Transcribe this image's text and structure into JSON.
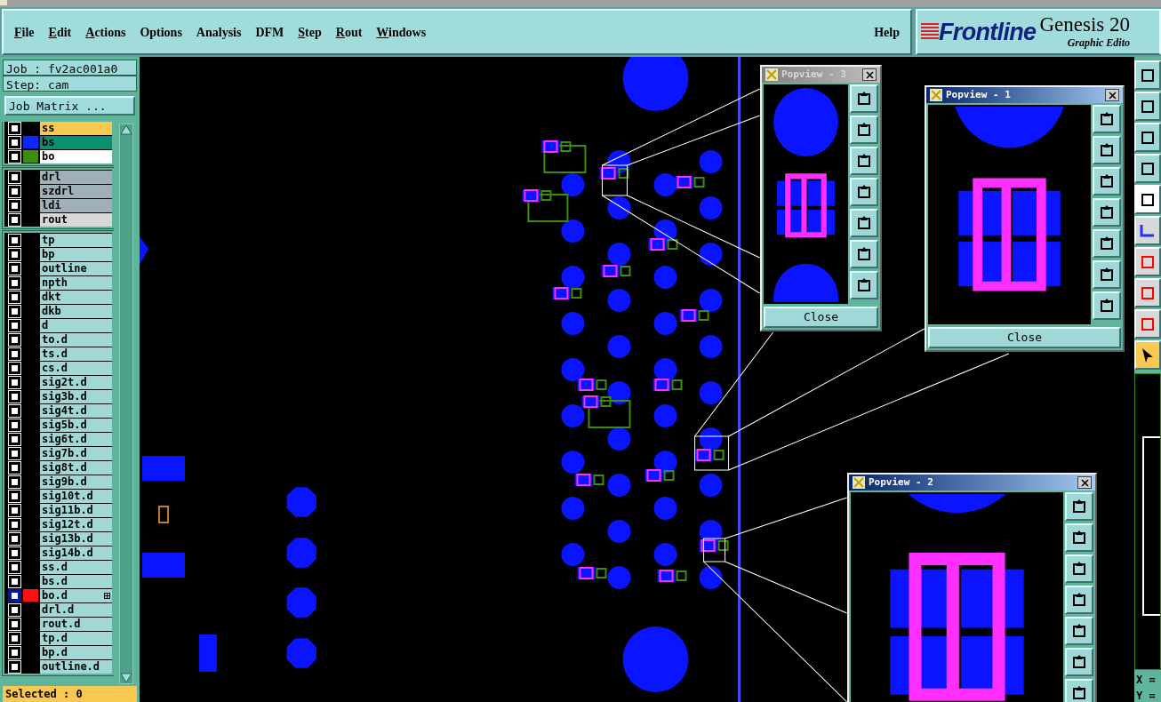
{
  "menu": [
    {
      "label": "File",
      "mnemonic": true
    },
    {
      "label": "Edit",
      "mnemonic": true
    },
    {
      "label": "Actions",
      "mnemonic": true
    },
    {
      "label": "Options",
      "mnemonic": false
    },
    {
      "label": "Analysis",
      "mnemonic": false
    },
    {
      "label": "DFM",
      "mnemonic": false
    },
    {
      "label": "Step",
      "mnemonic": true
    },
    {
      "label": "Rout",
      "mnemonic": true
    },
    {
      "label": "Windows",
      "mnemonic": true
    }
  ],
  "help": {
    "label": "Help"
  },
  "logo": {
    "brand": "Frontline",
    "product": "Genesis 20",
    "subtitle": "Graphic Edito"
  },
  "job": {
    "job": "Job : fv2ac001a0",
    "step": "Step: cam",
    "matrix_button": "Job Matrix ..."
  },
  "layer_groups": [
    {
      "layers": [
        {
          "name": "ss",
          "kind": "highlight",
          "active": false
        },
        {
          "name": "bs",
          "kind": "affected",
          "color": "#0a28ff",
          "active": false
        },
        {
          "name": "bo",
          "kind": "work",
          "color": "#3c8c10",
          "active": false
        }
      ]
    },
    {
      "layers": [
        {
          "name": "drl",
          "kind": "drill",
          "active": false
        },
        {
          "name": "szdrl",
          "kind": "drill",
          "active": false
        },
        {
          "name": "ldi",
          "kind": "drill",
          "active": false
        },
        {
          "name": "rout",
          "kind": "rout",
          "active": false
        }
      ]
    },
    {
      "layers": [
        {
          "name": "tp",
          "kind": "misc",
          "active": false
        },
        {
          "name": "bp",
          "kind": "misc",
          "active": false
        },
        {
          "name": "outline",
          "kind": "misc",
          "active": false
        },
        {
          "name": "npth",
          "kind": "misc",
          "active": false
        },
        {
          "name": "dkt",
          "kind": "misc",
          "active": false
        },
        {
          "name": "dkb",
          "kind": "misc",
          "active": false
        },
        {
          "name": "d",
          "kind": "misc",
          "active": false
        },
        {
          "name": "to.d",
          "kind": "misc",
          "active": false
        },
        {
          "name": "ts.d",
          "kind": "misc",
          "active": false
        },
        {
          "name": "cs.d",
          "kind": "misc",
          "active": false
        },
        {
          "name": "sig2t.d",
          "kind": "misc",
          "active": false
        },
        {
          "name": "sig3b.d",
          "kind": "misc",
          "active": false
        },
        {
          "name": "sig4t.d",
          "kind": "misc",
          "active": false
        },
        {
          "name": "sig5b.d",
          "kind": "misc",
          "active": false
        },
        {
          "name": "sig6t.d",
          "kind": "misc",
          "active": false
        },
        {
          "name": "sig7b.d",
          "kind": "misc",
          "active": false
        },
        {
          "name": "sig8t.d",
          "kind": "misc",
          "active": false
        },
        {
          "name": "sig9b.d",
          "kind": "misc",
          "active": false
        },
        {
          "name": "sig10t.d",
          "kind": "misc",
          "active": false
        },
        {
          "name": "sig11b.d",
          "kind": "misc",
          "active": false
        },
        {
          "name": "sig12t.d",
          "kind": "misc",
          "active": false
        },
        {
          "name": "sig13b.d",
          "kind": "misc",
          "active": false
        },
        {
          "name": "sig14b.d",
          "kind": "misc",
          "active": false
        },
        {
          "name": "ss.d",
          "kind": "misc",
          "active": false
        },
        {
          "name": "bs.d",
          "kind": "misc",
          "active": false
        },
        {
          "name": "bo.d",
          "kind": "misc",
          "color": "#ff1010",
          "active": true
        },
        {
          "name": "drl.d",
          "kind": "misc",
          "active": false
        },
        {
          "name": "rout.d",
          "kind": "misc",
          "active": false
        },
        {
          "name": "tp.d",
          "kind": "misc",
          "active": false
        },
        {
          "name": "bp.d",
          "kind": "misc",
          "active": false
        },
        {
          "name": "outline.d",
          "kind": "misc",
          "active": false
        }
      ]
    }
  ],
  "selected_status": "Selected : 0",
  "popviews": [
    {
      "title": "Popview - 3",
      "active": false,
      "close_button": "Close"
    },
    {
      "title": "Popview - 1",
      "active": true,
      "close_button": "Close"
    },
    {
      "title": "Popview - 2",
      "active": true
    }
  ],
  "coords": {
    "x": "X =",
    "y": "Y ="
  }
}
